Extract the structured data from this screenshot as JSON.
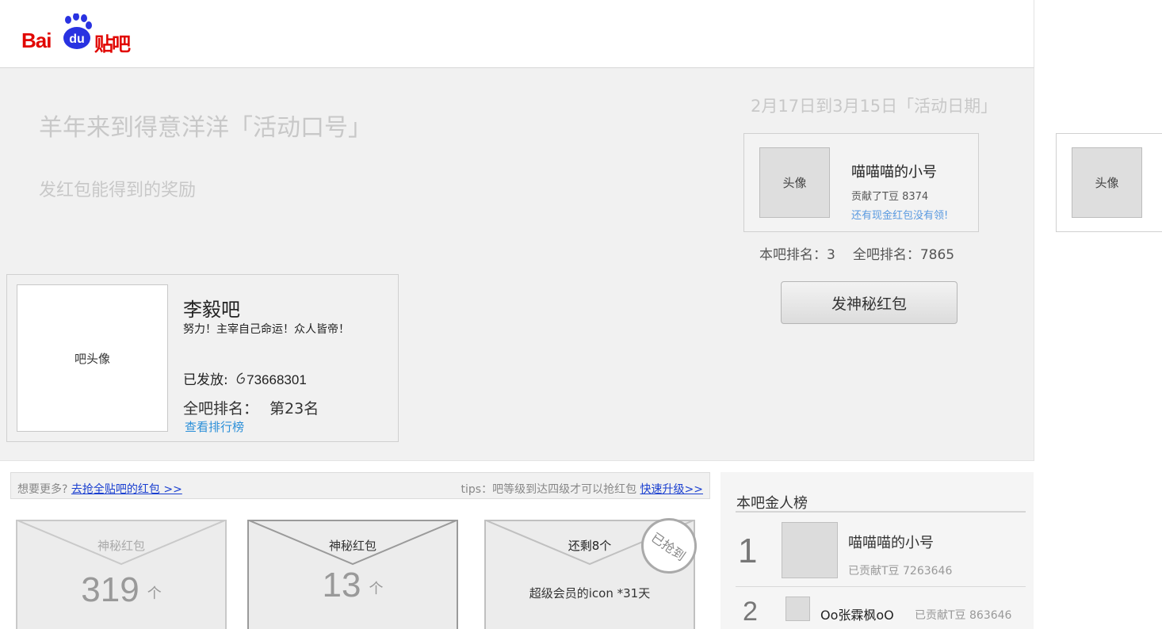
{
  "header": {
    "logo": {
      "text_bai": "Bai",
      "text_du": "du",
      "text_tieba": "贴吧"
    }
  },
  "banner": {
    "slogan": "羊年来到得意洋洋「活动口号」",
    "reward_desc": "发红包能得到的奖励",
    "event_date": "2月17日到3月15日「活动日期」",
    "user_card": {
      "avatar_label": "头像",
      "name": "喵喵喵的小号",
      "contribution": "贡献了T豆 8374",
      "cash_link": "还有现金红包没有领!"
    },
    "ranks": {
      "this_ba": "本吧排名：3",
      "all_ba": "全吧排名：7865"
    },
    "send_button": "发神秘红包",
    "side_card": {
      "avatar_label": "头像"
    },
    "ba_card": {
      "avatar_label": "吧头像",
      "name": "李毅吧",
      "motto": "努力！主宰自己命运！众人皆帝！",
      "released_label": "已发放:",
      "released_value": "73668301",
      "rank_label": "全吧排名：",
      "rank_value": "第23名",
      "leaderboard_link": "查看排行榜"
    }
  },
  "tips": {
    "want_more": "想要更多?",
    "grab_all_link": "去抢全贴吧的红包 >>",
    "tip_text": "tips：吧等级到达四级才可以抢红包",
    "upgrade_link": "快速升级>>"
  },
  "envelopes": [
    {
      "title": "神秘红包",
      "count": "319",
      "unit": "个"
    },
    {
      "title": "神秘红包",
      "count": "13",
      "unit": "个"
    },
    {
      "title": "还剩8个",
      "desc": "超级会员的icon *31天",
      "stamp": "已抢到"
    }
  ],
  "leaderboard": {
    "title": "本吧金人榜",
    "entries": [
      {
        "rank": "1",
        "name": "喵喵喵的小号",
        "contribution": "已贡献T豆  7263646"
      },
      {
        "rank": "2",
        "name": "Oo张霖枫oO",
        "contribution": "已贡献T豆  863646"
      }
    ]
  },
  "colors": {
    "brand_red": "#e10601",
    "brand_blue": "#2932e1",
    "link_blue": "#1a3fd0",
    "light_link_blue": "#5a9ae0"
  }
}
